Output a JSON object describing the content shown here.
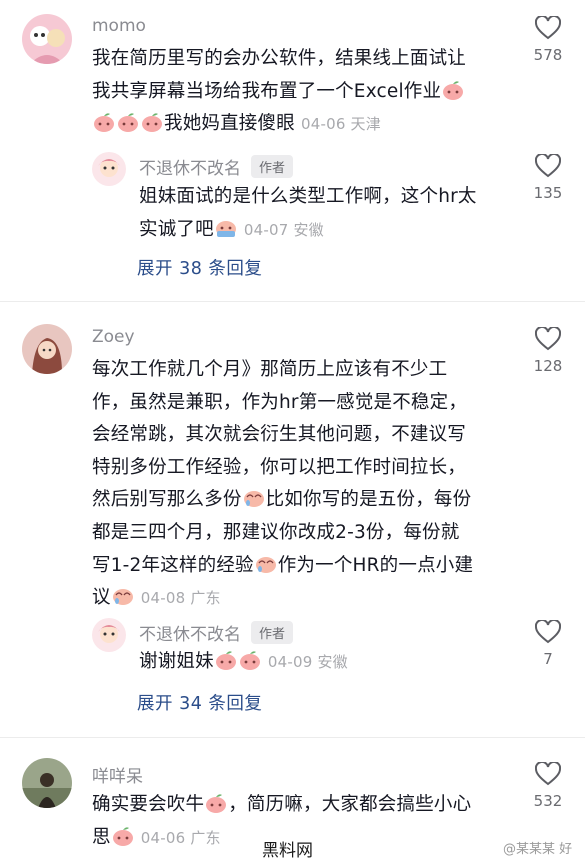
{
  "comments": [
    {
      "user": "momo",
      "lines": [
        "我在简历里写的会办公软件，结果线上面试让",
        "我共享屏幕当场给我布置了一个Excel作业"
      ],
      "tail": "我她妈直接傻眼",
      "meta": "04-06 天津",
      "likes": "578"
    },
    {
      "user": "不退休不改名",
      "tag": "作者",
      "lines": [
        "姐妹面试的是什么类型工作啊，这个hr太"
      ],
      "tail_pre": "实诚了吧",
      "meta": "04-07 安徽",
      "likes": "135",
      "expand": "展开 38 条回复"
    },
    {
      "user": "Zoey",
      "lines": [
        "每次工作就几个月》那简历上应该有不少工",
        "作，虽然是兼职，作为hr第一感觉是不稳定，",
        "会经常跳，其次就会衍生其他问题，不建议写",
        "特别多份工作经验，你可以把工作时间拉长，"
      ],
      "line5a": "然后别写那么多份",
      "line5b": "比如你写的是五份，每份",
      "line6": "都是三四个月，那建议你改成2-3份，每份就",
      "line7a": "写1-2年这样的经验",
      "line7b": "作为一个HR的一点小建",
      "line8": "议",
      "meta": "04-08 广东",
      "likes": "128"
    },
    {
      "user": "不退休不改名",
      "tag": "作者",
      "text": "谢谢姐妹",
      "meta": "04-09 安徽",
      "likes": "7",
      "expand": "展开 34 条回复"
    },
    {
      "user": "咩咩呆",
      "line1a": "确实要会吹牛",
      "line1b": "，简历嘛，大家都会搞些小心",
      "line2": "思",
      "meta": "04-06 广东",
      "likes": "532"
    }
  ],
  "watermark": "黑料网",
  "weibo_mark": "@某某某 好"
}
